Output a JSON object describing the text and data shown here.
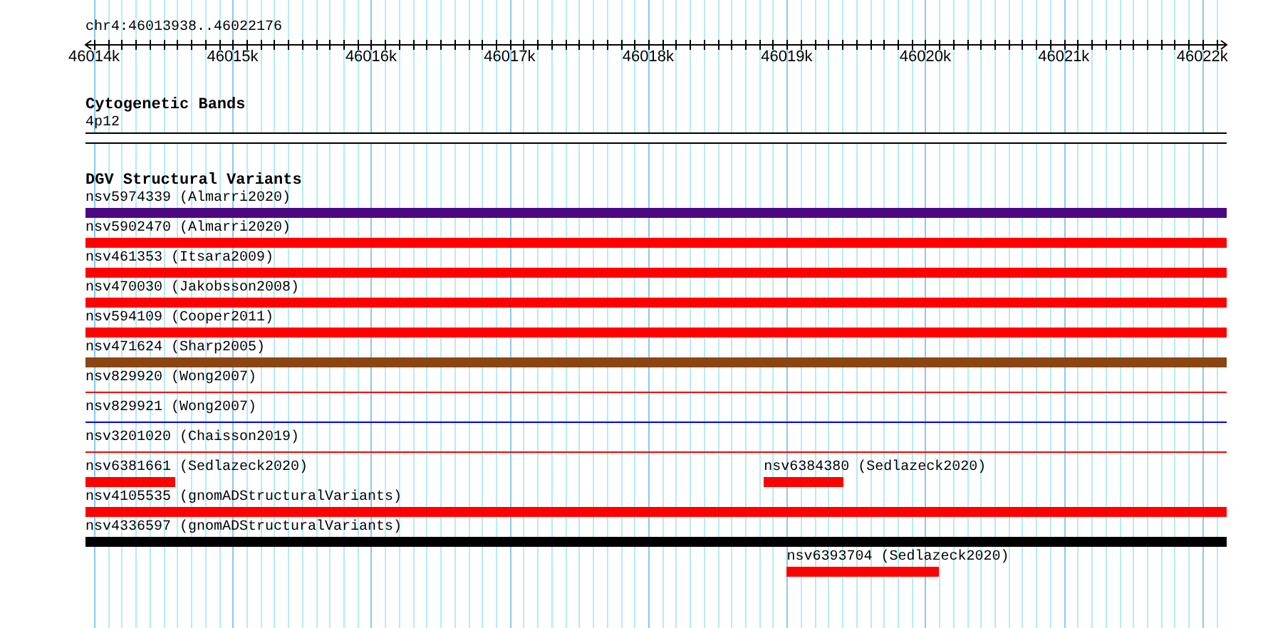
{
  "ruler": {
    "title": "chr4:46013938..46022176",
    "ticks": [
      {
        "label": "46014k"
      },
      {
        "label": "46015k"
      },
      {
        "label": "46016k"
      },
      {
        "label": "46017k"
      },
      {
        "label": "46018k"
      },
      {
        "label": "46019k"
      },
      {
        "label": "46020k"
      },
      {
        "label": "46021k"
      },
      {
        "label": "46022k"
      }
    ]
  },
  "cytoband_track": {
    "title": "Cytogenetic Bands",
    "bands": [
      {
        "label": "4p12"
      }
    ]
  },
  "variant_track": {
    "title": "DGV Structural Variants",
    "rows": [
      {
        "features": [
          {
            "label": "nsv5974339 (Almarri2020)",
            "kind": "bar",
            "color": "#4b0882"
          }
        ]
      },
      {
        "features": [
          {
            "label": "nsv5902470 (Almarri2020)",
            "kind": "bar",
            "color": "#ff0000"
          }
        ]
      },
      {
        "features": [
          {
            "label": "nsv461353 (Itsara2009)",
            "kind": "bar",
            "color": "#ff0000"
          }
        ]
      },
      {
        "features": [
          {
            "label": "nsv470030 (Jakobsson2008)",
            "kind": "bar",
            "color": "#ff0000"
          }
        ]
      },
      {
        "features": [
          {
            "label": "nsv594109 (Cooper2011)",
            "kind": "bar",
            "color": "#ff0000"
          }
        ]
      },
      {
        "features": [
          {
            "label": "nsv471624 (Sharp2005)",
            "kind": "bar",
            "color": "#8b4513"
          }
        ]
      },
      {
        "features": [
          {
            "label": "nsv829920 (Wong2007)",
            "kind": "line",
            "color": "#ff0000"
          }
        ]
      },
      {
        "features": [
          {
            "label": "nsv829921 (Wong2007)",
            "kind": "line",
            "color": "#0000ff"
          }
        ]
      },
      {
        "features": [
          {
            "label": "nsv3201020 (Chaisson2019)",
            "kind": "line",
            "color": "#ff0000"
          }
        ]
      },
      {
        "features": [
          {
            "label": "nsv6381661 (Sedlazeck2020)",
            "kind": "bar",
            "color": "#ff0000"
          },
          {
            "label": "nsv6384380 (Sedlazeck2020)",
            "kind": "bar",
            "color": "#ff0000"
          }
        ]
      },
      {
        "features": [
          {
            "label": "nsv4105535 (gnomADStructuralVariants)",
            "kind": "bar",
            "color": "#ff0000"
          }
        ]
      },
      {
        "features": [
          {
            "label": "nsv4336597 (gnomADStructuralVariants)",
            "kind": "bar",
            "color": "#000000"
          }
        ]
      },
      {
        "features": [
          {
            "label": "nsv6393704 (Sedlazeck2020)",
            "kind": "bar",
            "color": "#ff0000"
          }
        ]
      }
    ]
  }
}
